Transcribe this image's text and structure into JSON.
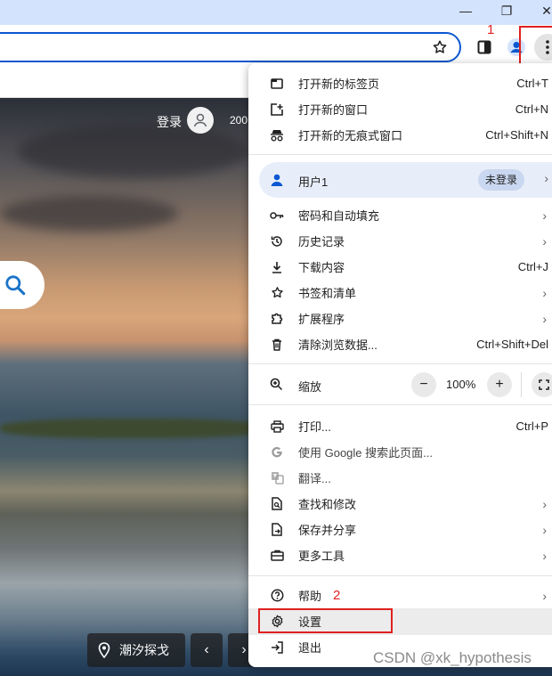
{
  "window_controls": {
    "minimize": "—",
    "restore": "❐",
    "close": "✕"
  },
  "annotations": {
    "step1": "1",
    "step2": "2"
  },
  "page": {
    "signin_label": "登录",
    "year_text": "200",
    "location_label": "潮汐探戈",
    "prev": "‹",
    "next": "›"
  },
  "menu": {
    "group1": [
      {
        "icon": "new-tab-icon",
        "label": "打开新的标签页",
        "shortcut": "Ctrl+T"
      },
      {
        "icon": "new-window-icon",
        "label": "打开新的窗口",
        "shortcut": "Ctrl+N"
      },
      {
        "icon": "incognito-icon",
        "label": "打开新的无痕式窗口",
        "shortcut": "Ctrl+Shift+N"
      }
    ],
    "profile": {
      "label": "用户1",
      "badge": "未登录",
      "arrow": "›"
    },
    "group2": [
      {
        "icon": "key-icon",
        "label": "密码和自动填充",
        "shortcut": "",
        "arrow": "›"
      },
      {
        "icon": "history-icon",
        "label": "历史记录",
        "shortcut": "",
        "arrow": "›"
      },
      {
        "icon": "download-icon",
        "label": "下载内容",
        "shortcut": "Ctrl+J",
        "arrow": ""
      },
      {
        "icon": "star-icon",
        "label": "书签和清单",
        "shortcut": "",
        "arrow": "›"
      },
      {
        "icon": "puzzle-icon",
        "label": "扩展程序",
        "shortcut": "",
        "arrow": "›"
      },
      {
        "icon": "trash-icon",
        "label": "清除浏览数据...",
        "shortcut": "Ctrl+Shift+Del",
        "arrow": ""
      }
    ],
    "zoom": {
      "label": "缩放",
      "minus": "−",
      "value": "100%",
      "plus": "+"
    },
    "group3": [
      {
        "icon": "print-icon",
        "label": "打印...",
        "shortcut": "Ctrl+P",
        "arrow": ""
      },
      {
        "icon": "google-icon",
        "label": "使用 Google 搜索此页面...",
        "shortcut": "",
        "arrow": ""
      },
      {
        "icon": "translate-icon",
        "label": "翻译...",
        "shortcut": "",
        "arrow": ""
      },
      {
        "icon": "find-icon",
        "label": "查找和修改",
        "shortcut": "",
        "arrow": "›"
      },
      {
        "icon": "save-share-icon",
        "label": "保存并分享",
        "shortcut": "",
        "arrow": "›"
      },
      {
        "icon": "toolbox-icon",
        "label": "更多工具",
        "shortcut": "",
        "arrow": "›"
      }
    ],
    "group4": [
      {
        "icon": "help-icon",
        "label": "帮助",
        "shortcut": "",
        "arrow": "›"
      },
      {
        "icon": "gear-icon",
        "label": "设置",
        "shortcut": "",
        "arrow": ""
      },
      {
        "icon": "exit-icon",
        "label": "退出",
        "shortcut": "",
        "arrow": ""
      }
    ]
  },
  "watermark": "CSDN @xk_hypothesis",
  "colors": {
    "accent": "#0b57d0",
    "highlight_box": "#e02020"
  }
}
